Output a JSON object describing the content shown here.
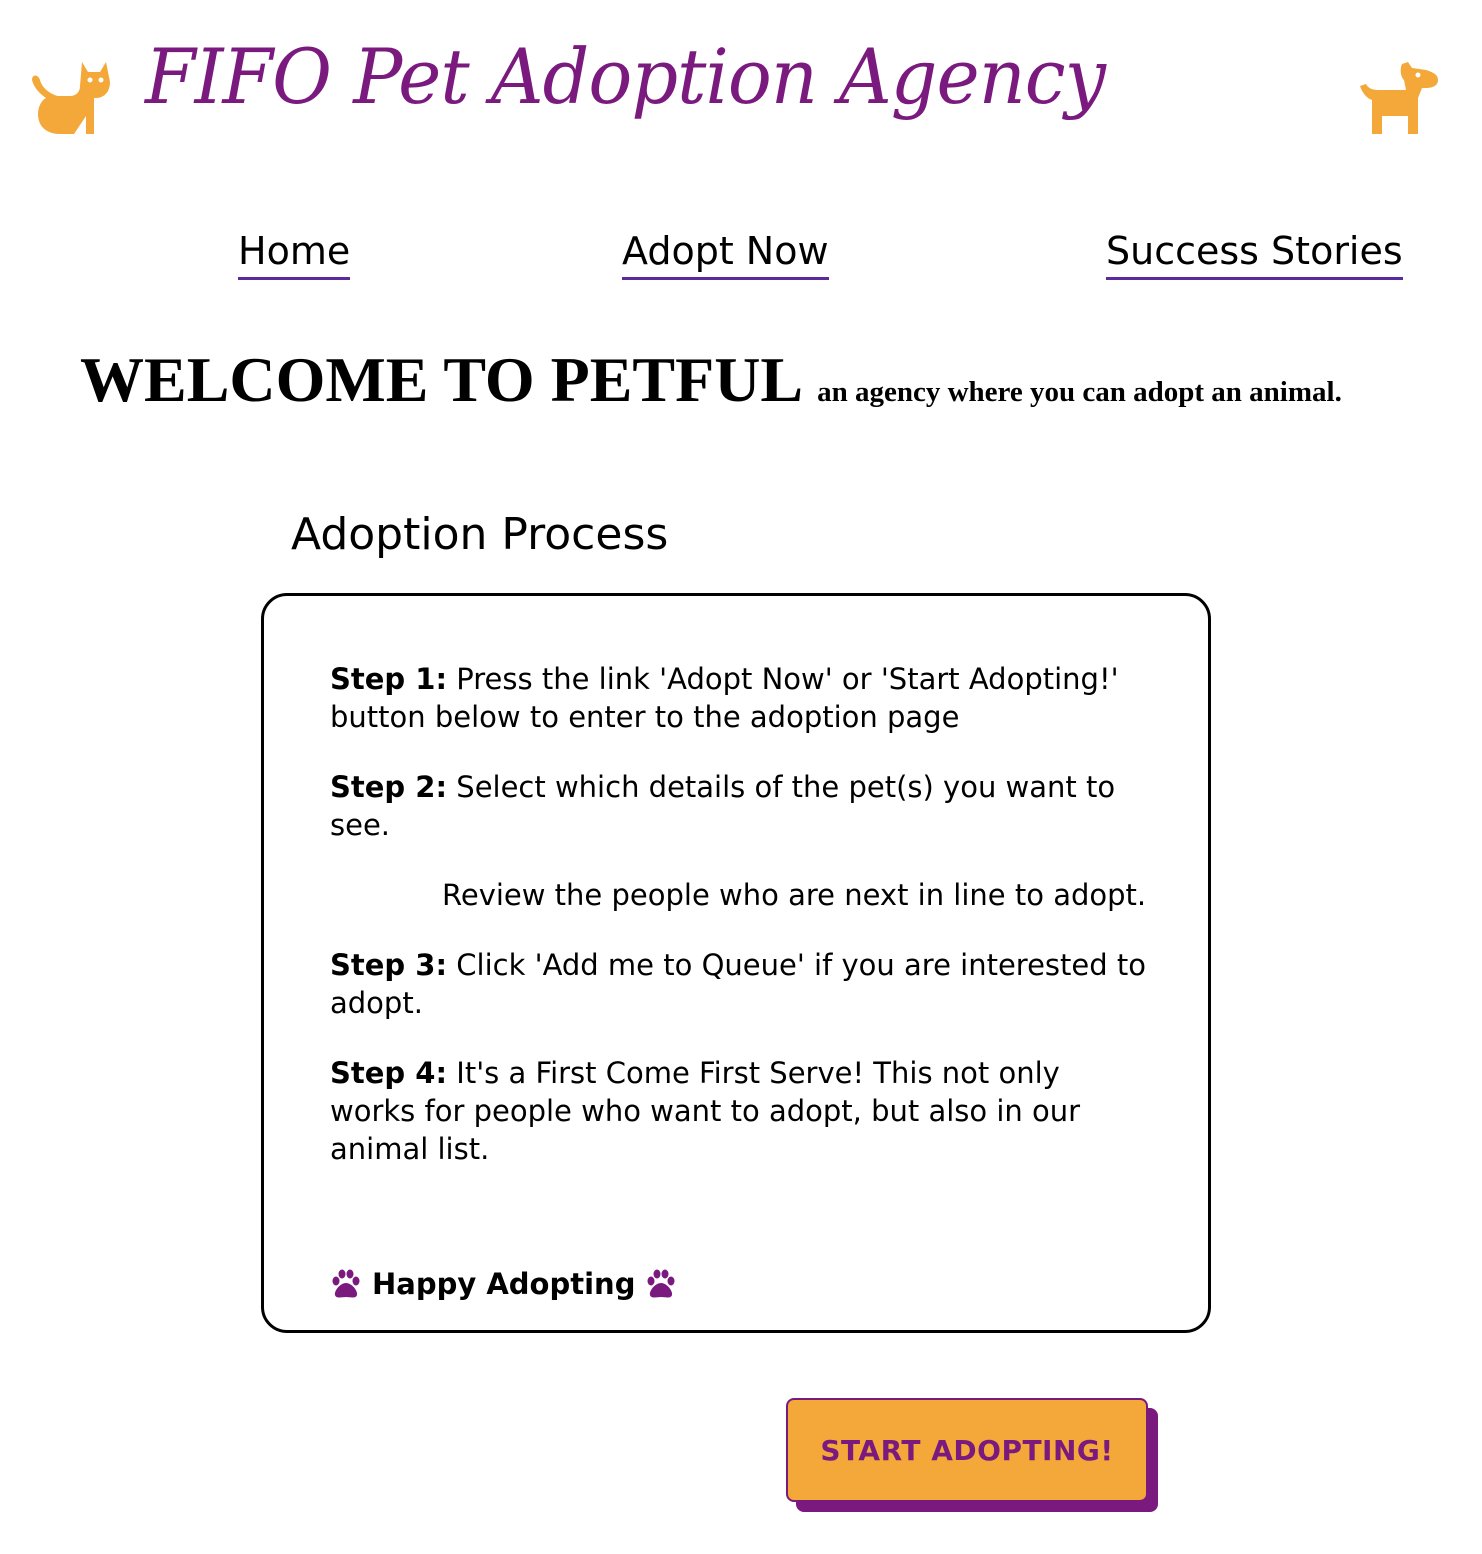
{
  "header": {
    "title": "FIFO Pet Adoption Agency",
    "left_icon": "cat-icon",
    "right_icon": "dog-icon"
  },
  "nav": {
    "home": "Home",
    "adopt_now": "Adopt Now",
    "success_stories": "Success Stories"
  },
  "welcome": {
    "title": "WELCOME TO PETFUL",
    "subtitle": "an agency where you can adopt an animal."
  },
  "process": {
    "heading": "Adoption Process",
    "steps": [
      {
        "label": "Step 1:",
        "text": " Press the link 'Adopt Now' or 'Start Adopting!' button below to enter to the adoption page"
      },
      {
        "label": "Step 2:",
        "text": " Select which details of the pet(s) you want to see."
      },
      {
        "label": "Step 3:",
        "text": " Click 'Add me to Queue' if you are interested to adopt."
      },
      {
        "label": "Step 4:",
        "text": " It's a First Come First Serve! This not only works for people who want to adopt, but also in our animal list."
      }
    ],
    "note": "Review the people who are next in line to adopt.",
    "closing": "Happy Adopting",
    "closing_icon": "paw-icon"
  },
  "cta": {
    "label": "START ADOPTING!"
  },
  "colors": {
    "brand_purple": "#7b1a7e",
    "accent_orange": "#f4a83a",
    "nav_underline": "#5a2a9e"
  }
}
